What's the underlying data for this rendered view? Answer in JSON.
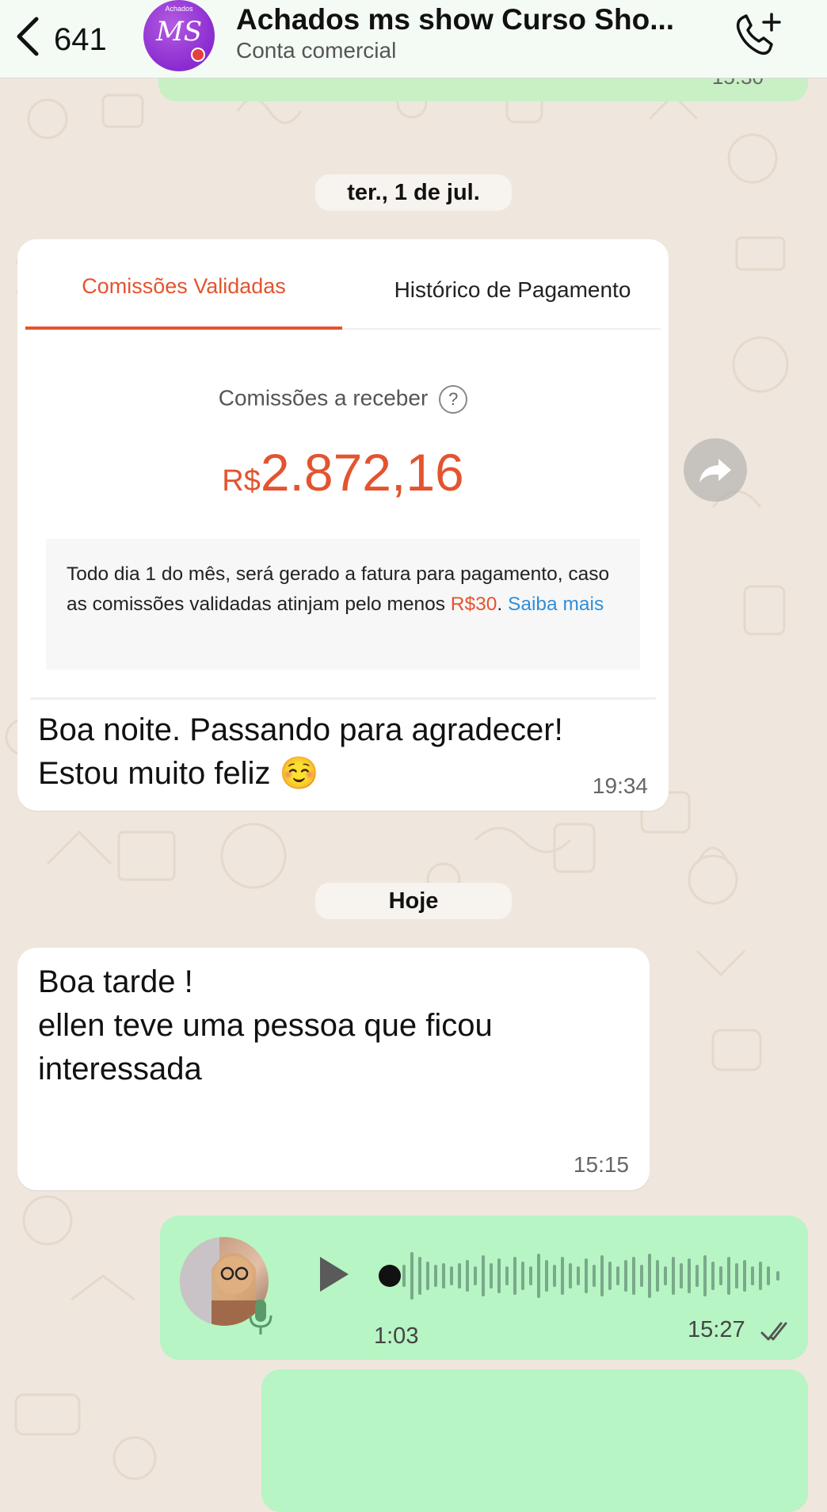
{
  "header": {
    "back_count": "641",
    "title": "Achados ms show Curso Sho...",
    "subtitle": "Conta comercial",
    "avatar_text": "MS",
    "avatar_small_text": "Achados"
  },
  "peek_message": {
    "time": "15:30"
  },
  "date_pills": {
    "first": "ter., 1 de jul.",
    "today": "Hoje"
  },
  "shared_card": {
    "tab_active": "Comissões Validadas",
    "tab_other": "Histórico de Pagamento",
    "label": "Comissões a receber",
    "help_icon": "?",
    "currency": "R$",
    "amount": "2.872,16",
    "info_part1": "Todo dia 1 do mês, será gerado a fatura para pagamento, caso as comissões validadas atinjam pelo menos ",
    "info_threshold": "R$30",
    "info_dot": ". ",
    "info_link": "Saiba mais"
  },
  "messages": [
    {
      "line1": "Boa noite. Passando para agradecer!",
      "line2": "Estou muito feliz ☺️",
      "time": "19:34"
    },
    {
      "line1": "Boa tarde !",
      "line2": " ellen teve uma pessoa que ficou",
      "line3": "interessada",
      "time": "15:15"
    }
  ],
  "audio": {
    "duration": "1:03",
    "time": "15:27"
  },
  "colors": {
    "accent": "#e3542f",
    "link": "#2f8fd8",
    "outgoing": "#b7f5c4",
    "chat_bg": "#efe7dd"
  }
}
